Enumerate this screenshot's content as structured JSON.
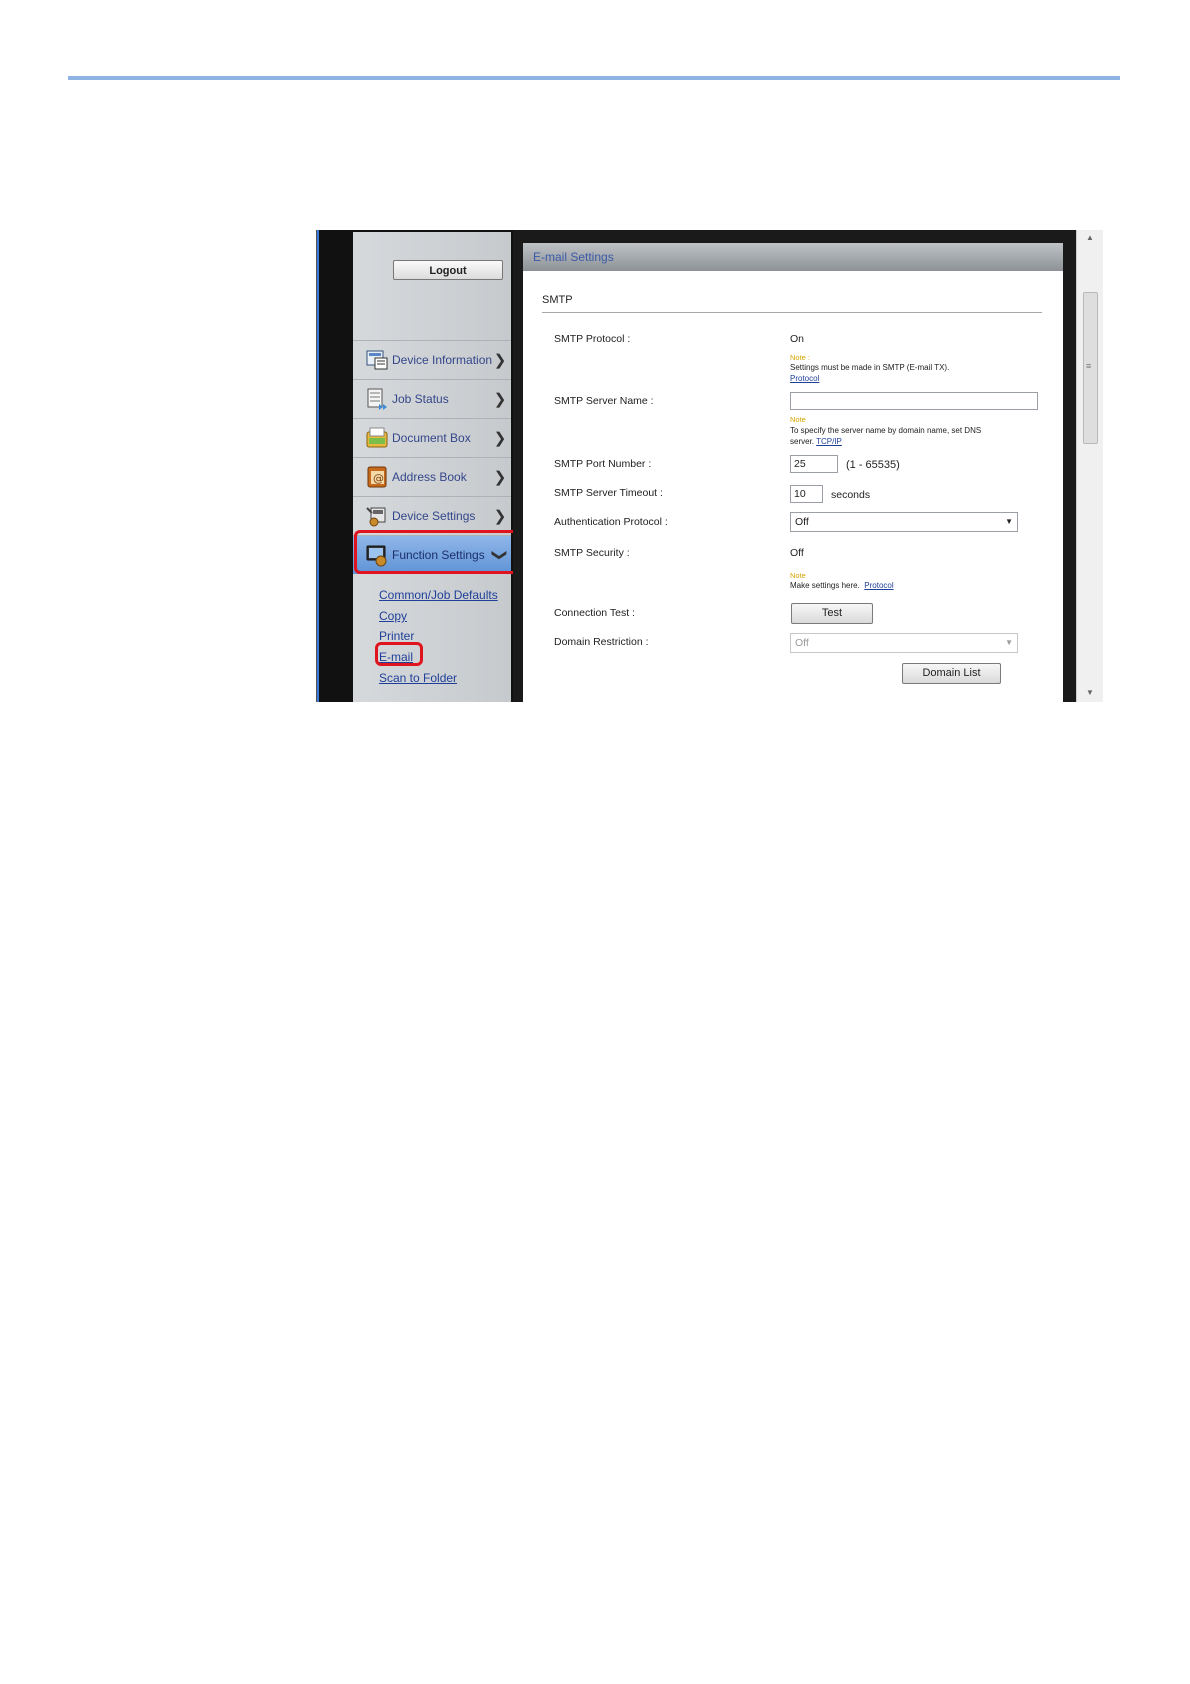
{
  "header": {
    "rule_color": "#8fb4e3"
  },
  "sidebar": {
    "logout_label": "Logout",
    "items": [
      {
        "label": "Device Information",
        "icon": "device-information-icon"
      },
      {
        "label": "Job Status",
        "icon": "job-status-icon"
      },
      {
        "label": "Document Box",
        "icon": "document-box-icon"
      },
      {
        "label": "Address Book",
        "icon": "address-book-icon"
      },
      {
        "label": "Device Settings",
        "icon": "device-settings-icon"
      },
      {
        "label": "Function Settings",
        "icon": "function-settings-icon",
        "expanded": true
      }
    ],
    "subitems": [
      "Common/Job Defaults",
      "Copy",
      "Printer",
      "E-mail",
      "Scan to Folder"
    ],
    "highlight_color": "#e0141e"
  },
  "panel": {
    "title": "E-mail Settings",
    "section": "SMTP",
    "rows": {
      "smtp_protocol": {
        "label": "SMTP Protocol :",
        "value": "On"
      },
      "smtp_protocol_note": {
        "heading": "Note :",
        "text": "Settings must be made in SMTP (E-mail TX).",
        "link": "Protocol"
      },
      "server_name": {
        "label": "SMTP Server Name :",
        "value": ""
      },
      "server_name_note": {
        "heading": "Note",
        "text1": "To specify the server name by domain name, set DNS",
        "text2": "server.",
        "link": "TCP/IP"
      },
      "port": {
        "label": "SMTP Port Number :",
        "value": "25",
        "range": "(1 - 65535)"
      },
      "timeout": {
        "label": "SMTP Server Timeout :",
        "value": "10",
        "unit": "seconds"
      },
      "auth": {
        "label": "Authentication Protocol :",
        "value": "Off"
      },
      "security": {
        "label": "SMTP Security :",
        "value": "Off"
      },
      "security_note": {
        "heading": "Note",
        "text": "Make settings here.",
        "link": "Protocol"
      },
      "conn_test": {
        "label": "Connection Test :",
        "button": "Test"
      },
      "domain": {
        "label": "Domain Restriction :",
        "value": "Off"
      },
      "domain_list_button": "Domain List"
    }
  }
}
